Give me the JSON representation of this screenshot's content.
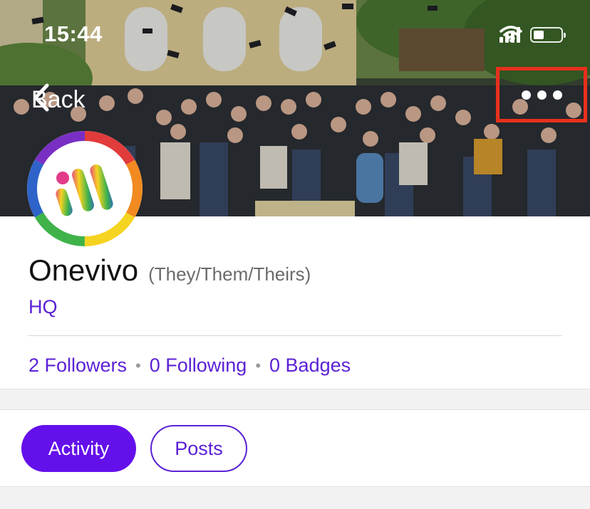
{
  "status_bar": {
    "time": "15:44",
    "signal_icon": "cellular-signal-icon",
    "wifi_icon": "wifi-icon",
    "battery_icon": "battery-icon"
  },
  "nav": {
    "back_label": "Back",
    "back_icon": "chevron-left-icon",
    "more_icon": "ellipsis-icon",
    "highlight_color": "#e8301c"
  },
  "profile": {
    "name": "Onevivo",
    "pronouns": "(They/Them/Theirs)",
    "department": "HQ",
    "stats": {
      "followers": "2 Followers",
      "following": "0 Following",
      "badges": "0 Badges",
      "separator": "•"
    }
  },
  "tabs": [
    {
      "label": "Activity",
      "active": true
    },
    {
      "label": "Posts",
      "active": false
    }
  ],
  "colors": {
    "accent": "#6410eb",
    "link": "#5b21d6",
    "muted_text": "#6b6b6b"
  }
}
